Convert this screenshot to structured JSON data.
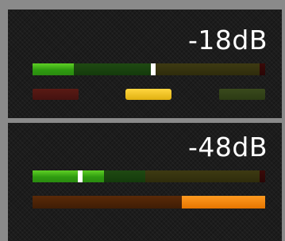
{
  "input_strip": {
    "level_label": "-18dB",
    "meter_value": 0.52,
    "indicators": [
      "red",
      "yellow",
      "green"
    ],
    "active_indicator": "yellow"
  },
  "output_strip": {
    "level_label": "-48dB",
    "meter_value": 0.205,
    "gain_reduction_value": 0.36
  },
  "colors": {
    "panel_bg": "#1c1c1c",
    "frame": "#8a8a8a",
    "meter_green": "#3fb018",
    "marker": "#ffffff",
    "indicator_yellow": "#f2c224",
    "gain_reduction_orange": "#f08a10"
  }
}
